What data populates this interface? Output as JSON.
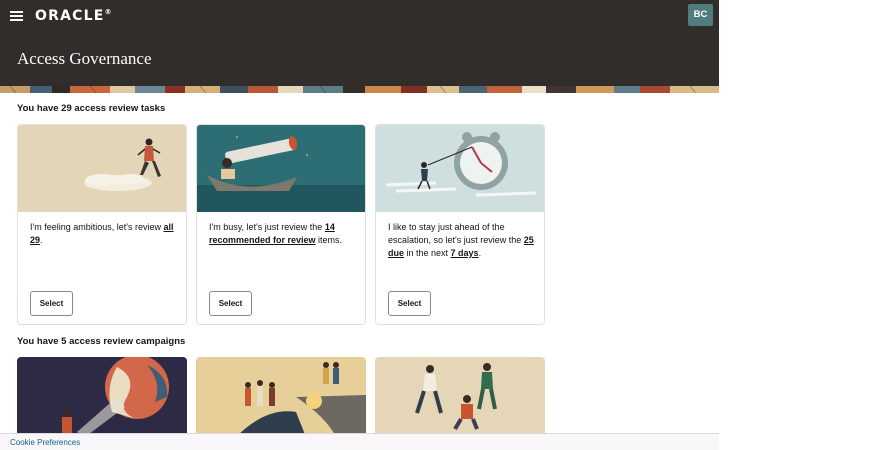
{
  "header": {
    "logo_text": "ORACLE",
    "logo_mark": "®",
    "page_title": "Access Governance",
    "avatar_initials": "BC",
    "menu_icon": "hamburger-menu-icon",
    "background_color": "#312d2a",
    "avatar_color": "#4f7d7b"
  },
  "tasks": {
    "heading": "You have 29 access review tasks",
    "cards": [
      {
        "text_before": "I'm feeling ambitious, let's review ",
        "link_1": "all 29",
        "text_middle": ".",
        "link_2": "",
        "text_after": "",
        "button_label": "Select",
        "image": "person-climbing-cloud-illustration"
      },
      {
        "text_before": "I'm busy, let's just review the ",
        "link_1": "14 recommended for review",
        "text_middle": " items.",
        "link_2": "",
        "text_after": "",
        "button_label": "Select",
        "image": "person-in-boat-with-telescope-illustration"
      },
      {
        "text_before": "I like to stay just ahead of the escalation, so let's just review the ",
        "link_1": "25 due",
        "text_middle": " in the next ",
        "link_2": "7 days",
        "text_after": ".",
        "button_label": "Select",
        "image": "person-pulling-clock-hand-illustration"
      }
    ]
  },
  "campaigns": {
    "heading": "You have 5 access review campaigns",
    "cards": [
      {
        "image": "person-with-flashlight-globe-illustration"
      },
      {
        "image": "group-on-cliff-illustration"
      },
      {
        "image": "people-playing-illustration"
      }
    ]
  },
  "footer": {
    "cookie_link": "Cookie Preferences"
  }
}
